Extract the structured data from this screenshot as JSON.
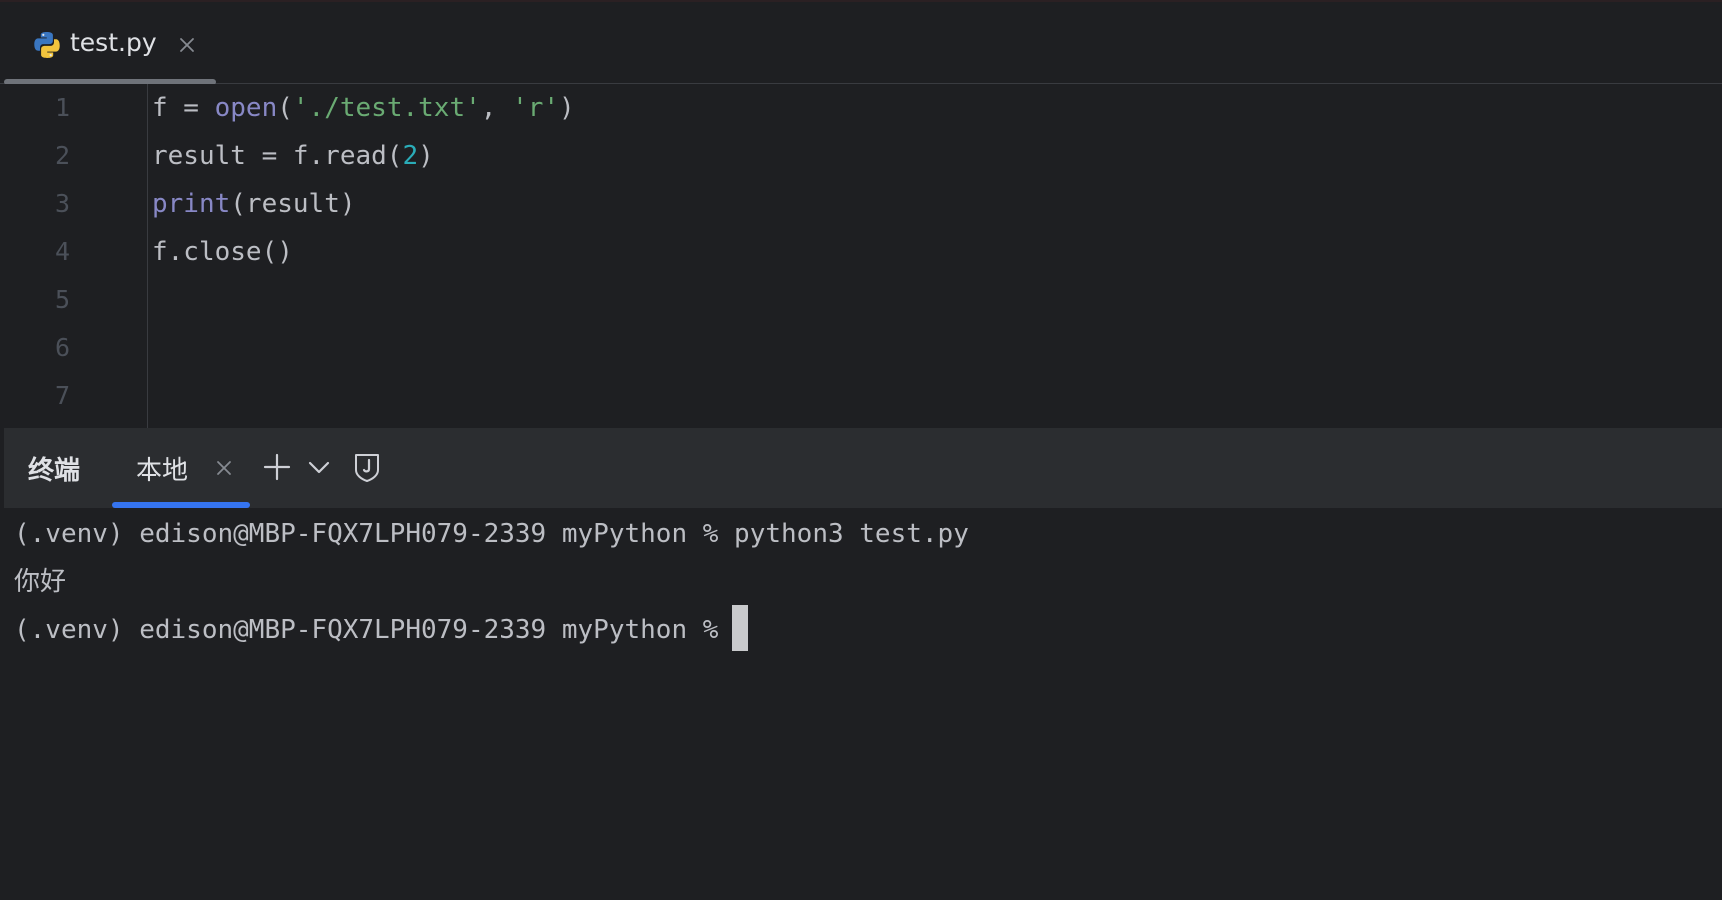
{
  "editor": {
    "tab": {
      "label": "test.py",
      "icon": "python-icon"
    },
    "lines": [
      {
        "number": "1",
        "tokens": [
          {
            "text": "f = ",
            "kind": "plain"
          },
          {
            "text": "open",
            "kind": "func"
          },
          {
            "text": "(",
            "kind": "plain"
          },
          {
            "text": "'./test.txt'",
            "kind": "str"
          },
          {
            "text": ", ",
            "kind": "plain"
          },
          {
            "text": "'r'",
            "kind": "str"
          },
          {
            "text": ")",
            "kind": "plain"
          }
        ]
      },
      {
        "number": "2",
        "tokens": [
          {
            "text": "result = f.read(",
            "kind": "plain"
          },
          {
            "text": "2",
            "kind": "num"
          },
          {
            "text": ")",
            "kind": "plain"
          }
        ]
      },
      {
        "number": "3",
        "tokens": [
          {
            "text": "print",
            "kind": "func"
          },
          {
            "text": "(result)",
            "kind": "plain"
          }
        ]
      },
      {
        "number": "4",
        "tokens": [
          {
            "text": "f.close()",
            "kind": "plain"
          }
        ]
      },
      {
        "number": "5",
        "tokens": []
      },
      {
        "number": "6",
        "tokens": []
      },
      {
        "number": "7",
        "tokens": []
      }
    ]
  },
  "terminal": {
    "title": "终端",
    "tab_label": "本地",
    "lines": [
      "(.venv) edison@MBP-FQX7LPH079-2339 myPython % python3 test.py",
      "你好",
      "(.venv) edison@MBP-FQX7LPH079-2339 myPython %"
    ]
  },
  "colors": {
    "background": "#1e1f22",
    "tool_header": "#2b2d30",
    "function": "#8888c6",
    "string": "#6aab73",
    "number": "#2aacb8",
    "active_tab_underline": "#3574f0"
  }
}
